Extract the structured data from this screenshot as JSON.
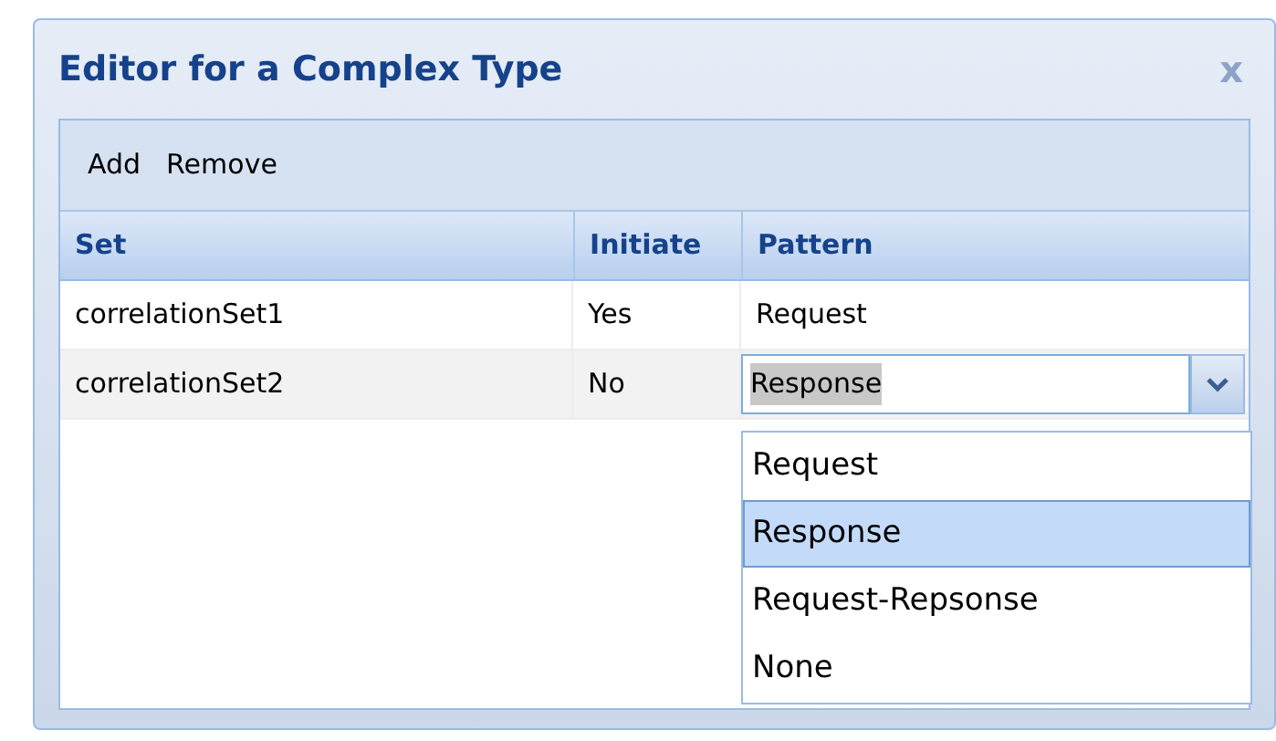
{
  "window": {
    "title": "Editor for a Complex Type",
    "close": "x"
  },
  "toolbar": [
    "Add",
    "Remove"
  ],
  "table": {
    "columns": [
      "Set",
      "Initiate",
      "Pattern"
    ],
    "rows": [
      {
        "set": "correlationSet1",
        "initiate": "Yes",
        "pattern": "Request",
        "editing": false
      },
      {
        "set": "correlationSet2",
        "initiate": "No",
        "pattern": "Response",
        "editing": true
      }
    ]
  },
  "dropdown": {
    "options": [
      {
        "label": "Request",
        "selected": false
      },
      {
        "label": "Response",
        "selected": true
      },
      {
        "label": "Request-Repsonse",
        "selected": false
      },
      {
        "label": "None",
        "selected": false
      }
    ]
  }
}
